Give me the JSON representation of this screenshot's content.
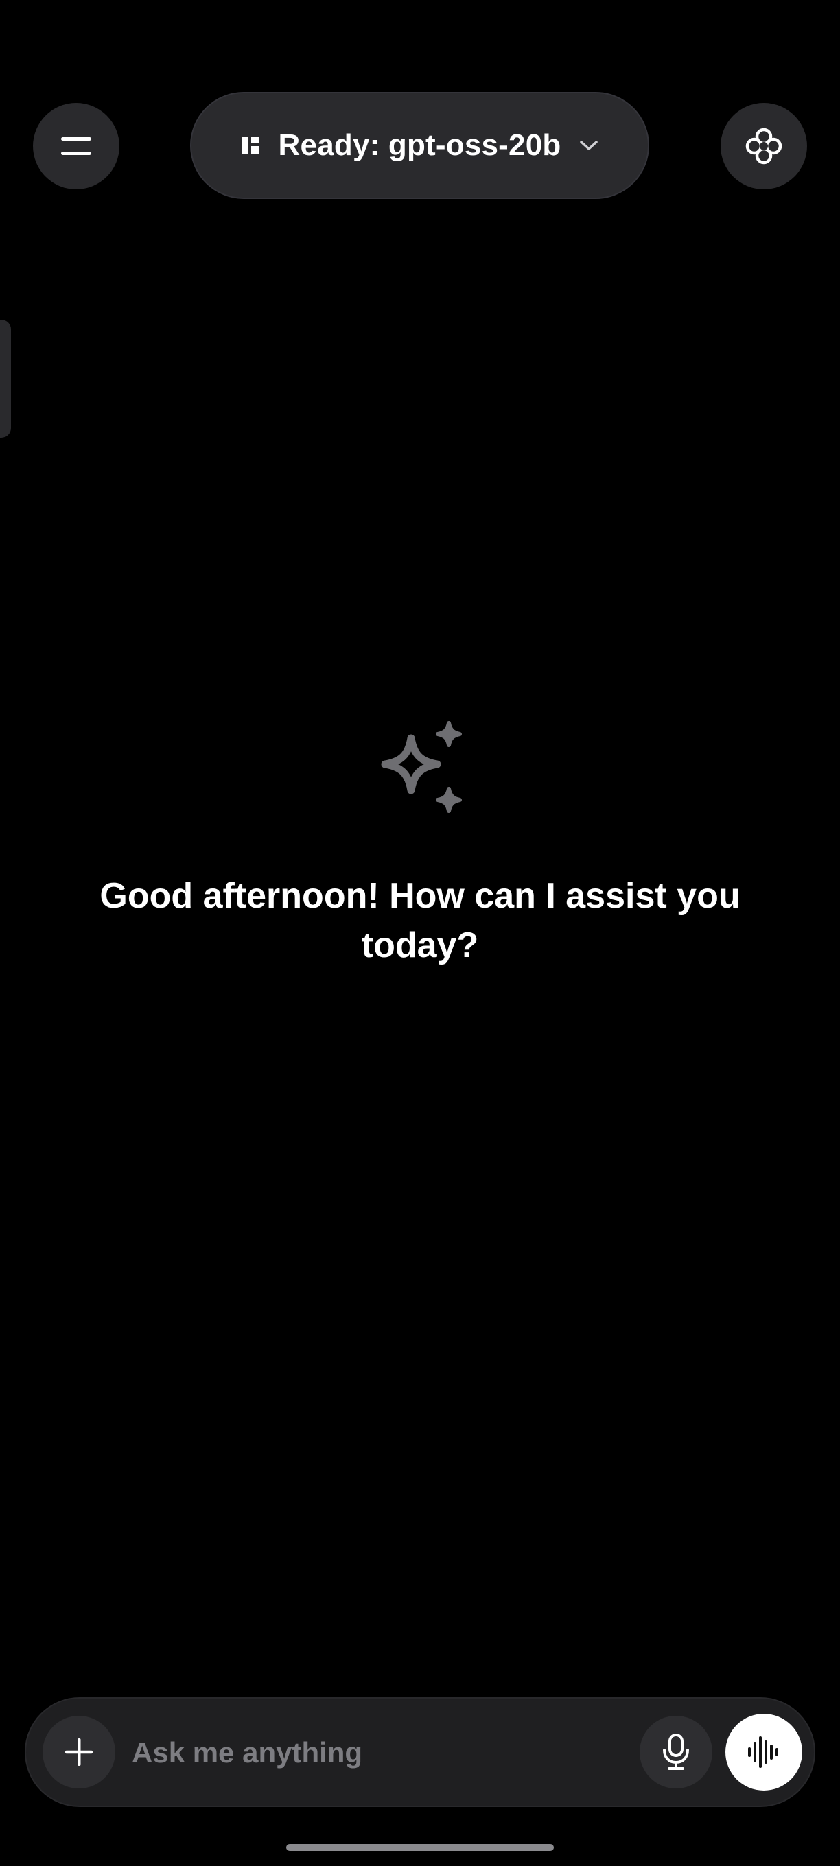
{
  "header": {
    "model_status": "Ready: gpt-oss-20b",
    "icons": {
      "menu": "menu-icon",
      "model_status": "model-status-icon",
      "dropdown": "chevron-down-icon",
      "brain": "brain-icon"
    }
  },
  "welcome": {
    "icon": "sparkles-icon",
    "greeting": "Good afternoon! How can I assist you today?"
  },
  "composer": {
    "placeholder": "Ask me anything",
    "value": "",
    "icons": {
      "attach": "plus-icon",
      "mic": "microphone-icon",
      "voice": "voice-waveform-icon"
    }
  },
  "colors": {
    "background": "#000000",
    "surface": "#2a2a2d",
    "composer": "#1f1f21",
    "text": "#ffffff",
    "muted": "#7d7d82",
    "icon_muted": "#6e6e72"
  }
}
